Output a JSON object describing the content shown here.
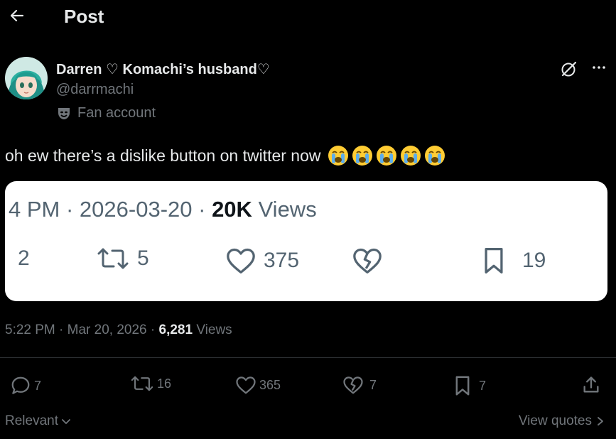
{
  "header": {
    "title": "Post"
  },
  "author": {
    "name": "Darren ♡ Komachi’s husband♡",
    "handle": "@darrmachi",
    "badge_label": "Fan account"
  },
  "tweet": {
    "text": "oh ew there’s a dislike button on twitter now",
    "emoji_count": 5
  },
  "quoted_card": {
    "time": "4 PM",
    "date": "2026-03-20",
    "views_count": "20K",
    "views_label": "Views",
    "replies": "2",
    "reposts": "5",
    "likes": "375",
    "bookmarks": "19"
  },
  "meta": {
    "time": "5:22 PM",
    "date": "Mar 20, 2026",
    "views_count": "6,281",
    "views_label": "Views"
  },
  "actions": {
    "replies": "7",
    "reposts": "16",
    "likes": "365",
    "dislikes": "7",
    "bookmarks": "7"
  },
  "footer": {
    "sort_label": "Relevant",
    "quotes_label": "View quotes"
  },
  "colors": {
    "background": "#000000",
    "text_primary": "#e7e9ea",
    "text_secondary": "#71767b",
    "card_background": "#ffffff",
    "card_text": "#536471"
  }
}
